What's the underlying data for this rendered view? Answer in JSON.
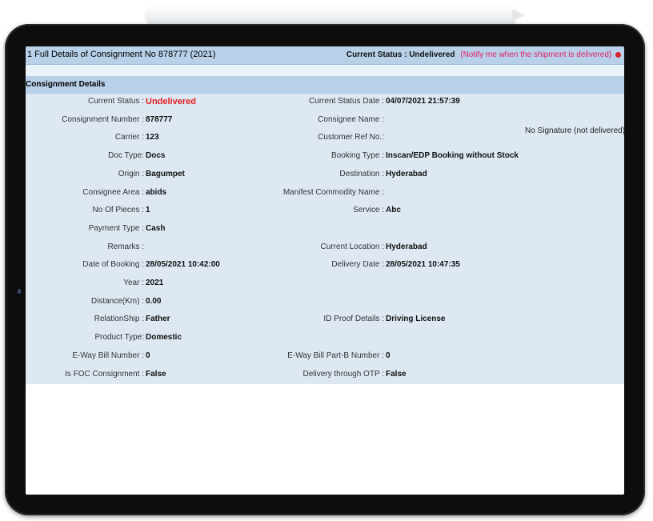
{
  "header": {
    "title": "1   Full Details of Consignment No 878777 (2021)",
    "current_status": "Current Status : Undelivered",
    "notify_link": "(Notify me when the shipment is delivered)"
  },
  "section": {
    "title": "Consignment Details"
  },
  "signature_note": "No Signature (not delivered)",
  "rows": [
    {
      "l1": "Current Status :",
      "v1": "Undelivered",
      "l2": "Current Status Date :",
      "v2": "04/07/2021 21:57:39"
    },
    {
      "l1": "Consignment Number :",
      "v1": "878777",
      "l2": "Consignee Name :",
      "v2": ""
    },
    {
      "l1": "Carrier :",
      "v1": "123",
      "l2": "Customer Ref No.:",
      "v2": ""
    },
    {
      "l1": "Doc Type:",
      "v1": "Docs",
      "l2": "Booking Type :",
      "v2": "Inscan/EDP Booking without Stock"
    },
    {
      "l1": "Origin :",
      "v1": "Bagumpet",
      "l2": "Destination :",
      "v2": "Hyderabad"
    },
    {
      "l1": "Consignee Area :",
      "v1": "abids",
      "l2": "Manifest Commodity Name :",
      "v2": ""
    },
    {
      "l1": "No Of Pieces :",
      "v1": "1",
      "l2": "Service :",
      "v2": "Abc"
    },
    {
      "l1": "Payment Type :",
      "v1": "Cash",
      "l2": "",
      "v2": ""
    },
    {
      "l1": "Remarks :",
      "v1": "",
      "l2": "Current Location :",
      "v2": "Hyderabad"
    },
    {
      "l1": "Date of Booking :",
      "v1": "28/05/2021 10:42:00",
      "l2": "Delivery Date :",
      "v2": "28/05/2021 10:47:35"
    },
    {
      "l1": "Year :",
      "v1": "2021",
      "l2": "",
      "v2": ""
    },
    {
      "l1": "Distance(Km) :",
      "v1": "0.00",
      "l2": "",
      "v2": ""
    },
    {
      "l1": "RelationShip :",
      "v1": "Father",
      "l2": "ID Proof Details :",
      "v2": "Driving License"
    },
    {
      "l1": "Product Type:",
      "v1": "Domestic",
      "l2": "",
      "v2": ""
    },
    {
      "l1": "E-Way Bill Number :",
      "v1": "0",
      "l2": "E-Way Bill Part-B Number :",
      "v2": "0"
    },
    {
      "l1": "Is FOC Consignment :",
      "v1": "False",
      "l2": "Delivery through OTP :",
      "v2": "False"
    }
  ],
  "colors": {
    "header_bg": "#b8d0e8",
    "panel_bg": "#dde8f3",
    "status_red": "#e01e1e",
    "notify_pink": "#e0206a"
  }
}
